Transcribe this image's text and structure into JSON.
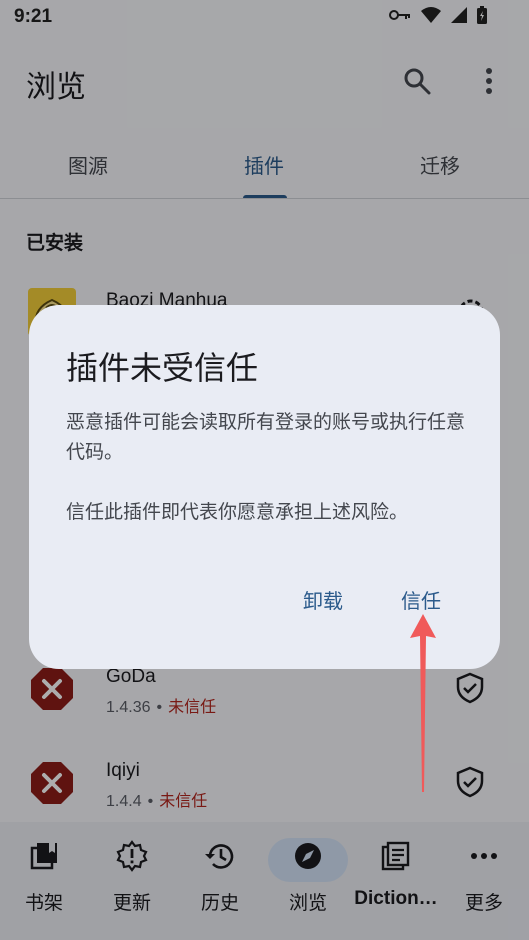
{
  "status_bar": {
    "time": "9:21"
  },
  "app_bar": {
    "title": "浏览"
  },
  "tabs": [
    {
      "label": "图源"
    },
    {
      "label": "插件"
    },
    {
      "label": "迁移"
    }
  ],
  "section": {
    "installed": "已安装"
  },
  "extensions": [
    {
      "name": "Baozi Manhua"
    },
    {
      "name": "GoDa",
      "version": "1.4.36",
      "separator": "•",
      "status": "未信任"
    },
    {
      "name": "Iqiyi",
      "version": "1.4.4",
      "separator": "•",
      "status": "未信任"
    }
  ],
  "dialog": {
    "title": "插件未受信任",
    "body_1": "恶意插件可能会读取所有登录的账号或执行任意代码。",
    "body_2": "信任此插件即代表你愿意承担上述风险。",
    "uninstall_label": "卸载",
    "trust_label": "信任"
  },
  "bottom_nav": [
    {
      "label": "书架",
      "icon": "bookshelf-icon"
    },
    {
      "label": "更新",
      "icon": "updates-icon"
    },
    {
      "label": "历史",
      "icon": "history-icon"
    },
    {
      "label": "浏览",
      "icon": "browse-icon"
    },
    {
      "label": "Diction…",
      "icon": "dictionary-icon"
    },
    {
      "label": "更多",
      "icon": "more-icon"
    }
  ],
  "colors": {
    "accent": "#2b5a8b",
    "untrusted": "#b3261e",
    "annotation_arrow": "#f05a5a"
  }
}
